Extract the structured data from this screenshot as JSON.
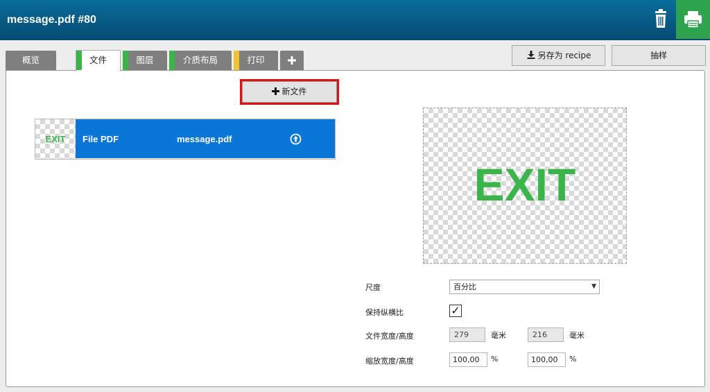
{
  "window": {
    "title": "message.pdf #80"
  },
  "header_icons": {
    "trash": "trash-icon",
    "print": "printer-icon",
    "print_bg": "#2ea44f"
  },
  "tabs": [
    {
      "label": "概览",
      "stripe": ""
    },
    {
      "label": "文件",
      "stripe": "#3bb44a",
      "active": true
    },
    {
      "label": "图层",
      "stripe": "#3bb44a"
    },
    {
      "label": "介质布局",
      "stripe": "#3bb44a"
    },
    {
      "label": "打印",
      "stripe": "#f4c430"
    }
  ],
  "add_tab_icon": "plus-icon",
  "toolbar": {
    "save_recipe": "另存为 recipe",
    "sample": "抽样"
  },
  "new_file_button": "新文件",
  "file": {
    "thumb_text": "EXIT",
    "type": "File PDF",
    "name": "message.pdf"
  },
  "preview": {
    "text": "EXIT"
  },
  "properties": {
    "scale_label": "尺度",
    "scale_value": "百分比",
    "aspect_label": "保持纵横比",
    "aspect_checked": "✓",
    "doc_size_label": "文件宽度/高度",
    "doc_width": "279",
    "doc_height": "216",
    "doc_unit": "毫米",
    "zoom_label": "缩放宽度/高度",
    "zoom_width": "100,00",
    "zoom_height": "100,00",
    "zoom_unit": "%"
  }
}
